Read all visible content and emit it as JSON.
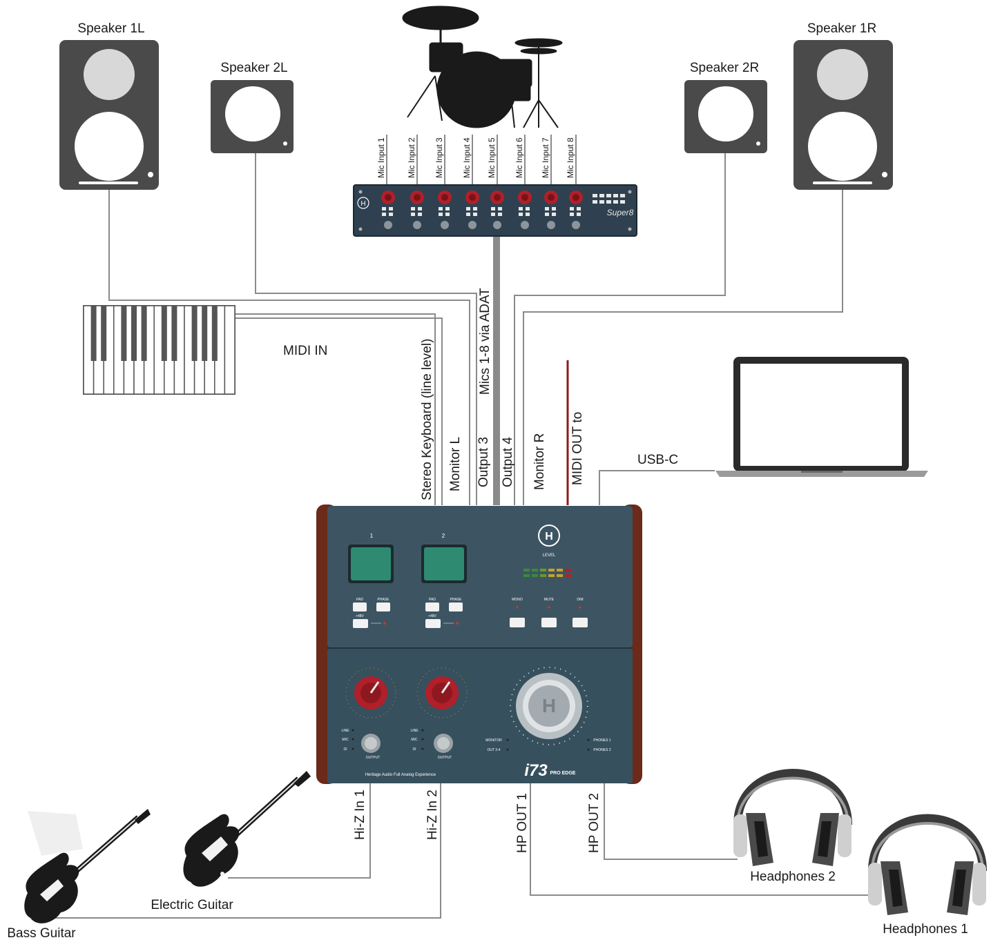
{
  "speakers": {
    "speaker_1l": "Speaker 1L",
    "speaker_2l": "Speaker 2L",
    "speaker_2r": "Speaker 2R",
    "speaker_1r": "Speaker 1R"
  },
  "preamp": {
    "mic_inputs": [
      "Mic Input 1",
      "Mic Input 2",
      "Mic Input 3",
      "Mic Input 4",
      "Mic Input 5",
      "Mic Input 6",
      "Mic Input 7",
      "Mic Input 8"
    ],
    "model_label": "Super8"
  },
  "keyboard": {
    "midi_in": "MIDI IN"
  },
  "connections": {
    "stereo_keyboard": "Stereo Keyboard (line level)",
    "monitor_l": "Monitor L",
    "mics_adat": "Mics 1-8 via ADAT",
    "output_3": "Output 3",
    "output_4": "Output 4",
    "monitor_r": "Monitor R",
    "midi_out": "MIDI OUT to",
    "usb_c": "USB-C",
    "hiz_in_1": "Hi-Z In 1",
    "hiz_in_2": "Hi-Z In 2",
    "hp_out_1": "HP OUT 1",
    "hp_out_2": "HP OUT 2"
  },
  "interface": {
    "ch1": "1",
    "ch2": "2",
    "pad": "PAD",
    "phase": "PHASE",
    "plus48": "+48V",
    "level": "LEVEL",
    "mono": "MONO",
    "mute": "MUTE",
    "dim": "DIM",
    "line": "LINE",
    "mic": "MIC",
    "di": "DI",
    "output": "OUTPUT",
    "monitor": "MONITOR",
    "out34": "OUT 3-4",
    "phones1": "PHONES 1",
    "phones2": "PHONES 2",
    "tagline": "Heritage Audio Full Analog Experience",
    "brand_big": "i73",
    "brand_small": "PRO EDGE"
  },
  "peripherals": {
    "headphones_2": "Headphones 2",
    "headphones_1": "Headphones 1",
    "electric_guitar": "Electric Guitar",
    "bass_guitar": "Bass Guitar"
  },
  "colors": {
    "wire": "#8a8a8a",
    "midi_wire": "#8b1a1a",
    "device_body": "#3d5563",
    "wood": "#6b2a1a",
    "speaker": "#4a4a4a"
  }
}
